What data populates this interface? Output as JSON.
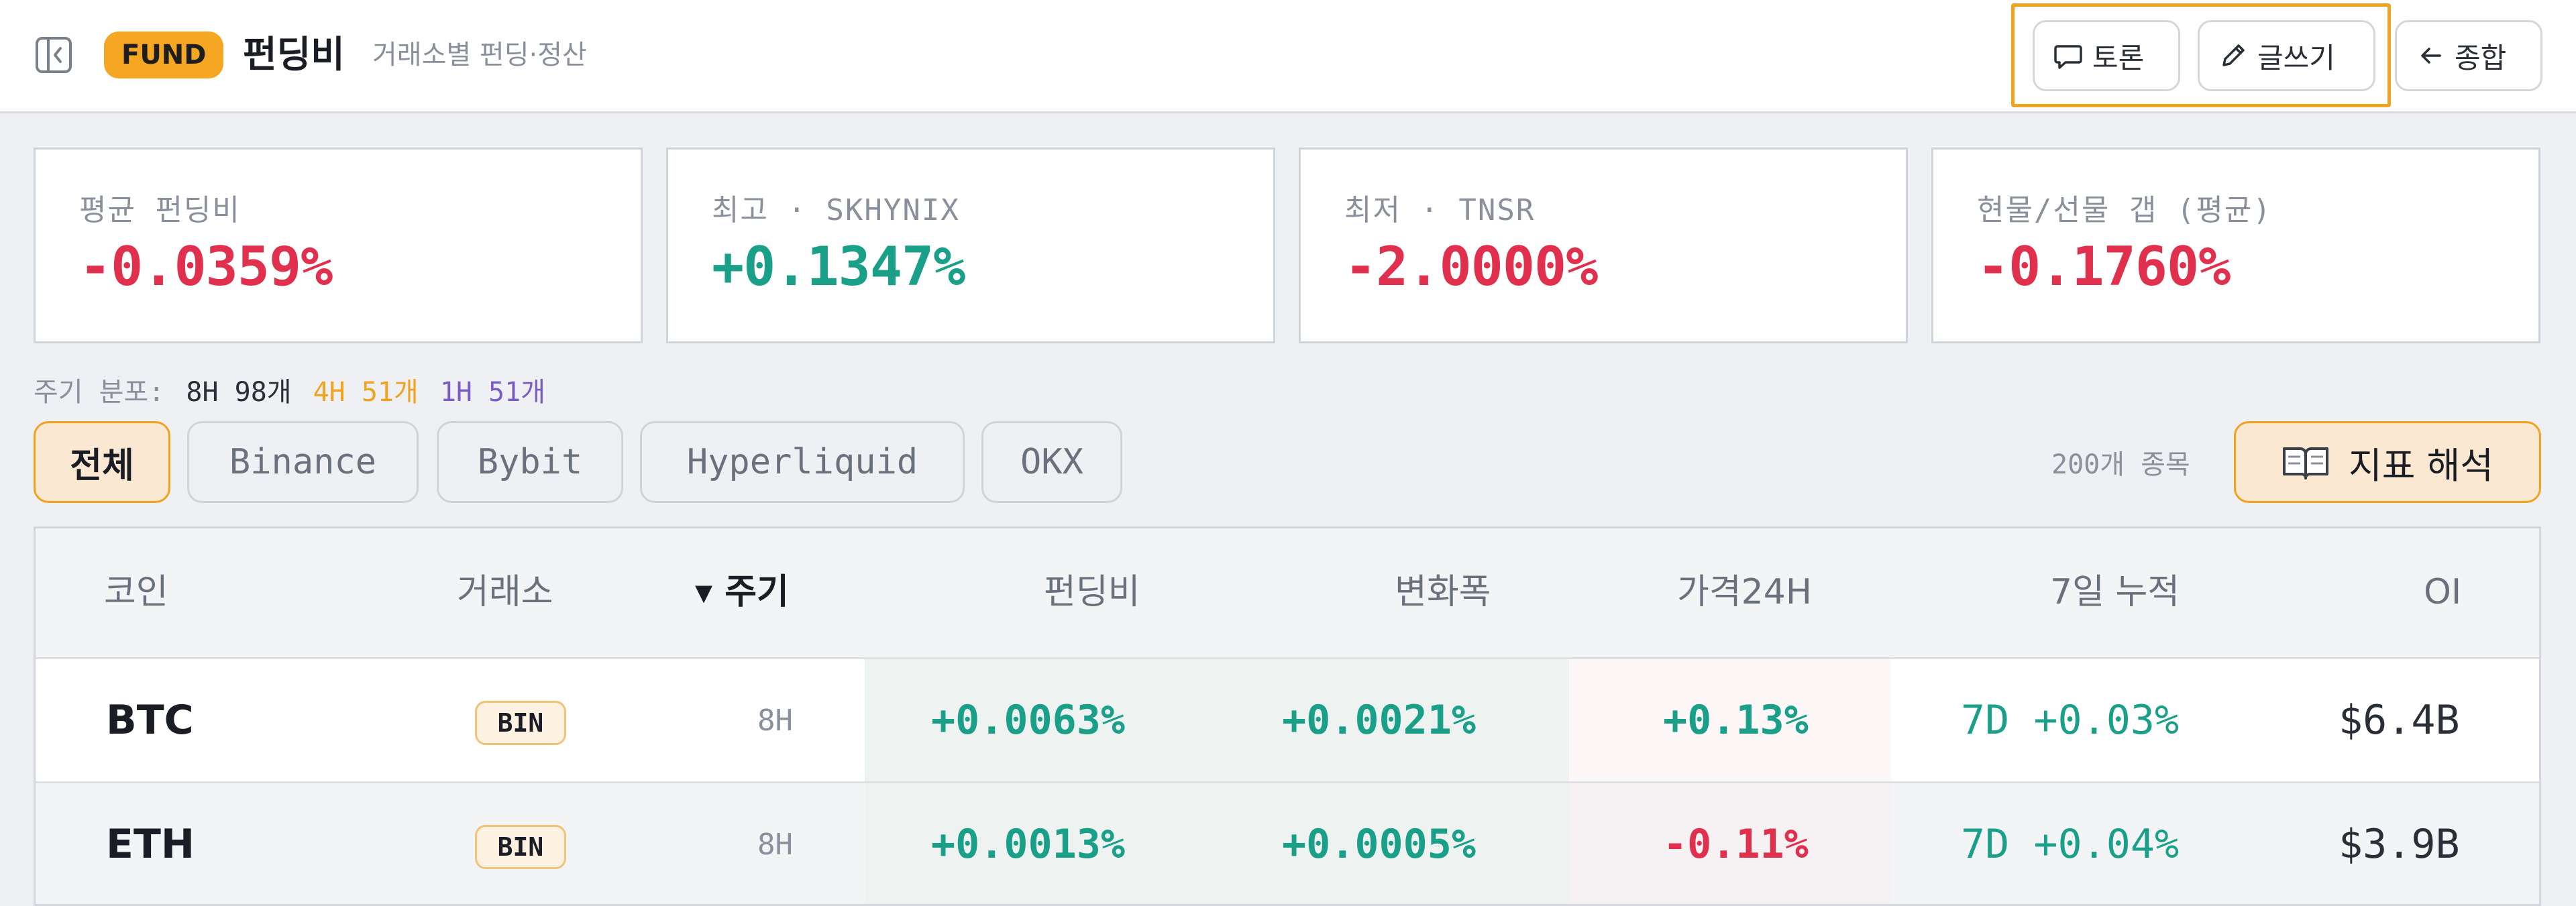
{
  "header": {
    "badge": "FUND",
    "title": "펀딩비",
    "subtitle": "거래소별 펀딩·정산",
    "buttons": {
      "discuss": "토론",
      "write": "글쓰기",
      "back": "종합"
    }
  },
  "stats": [
    {
      "label": "평균 펀딩비",
      "value": "-0.0359%",
      "tone": "negative"
    },
    {
      "label": "최고 · SKHYNIX",
      "value": "+0.1347%",
      "tone": "positive"
    },
    {
      "label": "최저 · TNSR",
      "value": "-2.0000%",
      "tone": "negative"
    },
    {
      "label": "현물/선물 갭 (평균)",
      "value": "-0.1760%",
      "tone": "negative"
    }
  ],
  "cycle_distribution": {
    "label": "주기 분포:",
    "h8": "8H 98개",
    "h4": "4H 51개",
    "h1": "1H 51개"
  },
  "filters": {
    "tabs": [
      "전체",
      "Binance",
      "Bybit",
      "Hyperliquid",
      "OKX"
    ],
    "active": "전체",
    "count": "200개 종목",
    "guide_label": "지표 해석"
  },
  "table": {
    "columns": [
      "코인",
      "거래소",
      "▾ 주기",
      "펀딩비",
      "변화폭",
      "가격24H",
      "7일 누적",
      "OI"
    ],
    "sorted_column": "주기",
    "rows": [
      {
        "coin": "BTC",
        "exchange": "BIN",
        "period": "8H",
        "funding": "+0.0063%",
        "change": "+0.0021%",
        "price24h": "+0.13%",
        "cum7d": "7D +0.03%",
        "oi": "$6.4B"
      },
      {
        "coin": "ETH",
        "exchange": "BIN",
        "period": "8H",
        "funding": "+0.0013%",
        "change": "+0.0005%",
        "price24h": "-0.11%",
        "cum7d": "7D +0.04%",
        "oi": "$3.9B"
      }
    ]
  },
  "colors": {
    "accent": "#f0a31e",
    "positive": "#1aa089",
    "negative": "#e0304d",
    "cycle_4h": "#f0a31e",
    "cycle_1h": "#7b5cc4"
  },
  "icons": {
    "sidebar_toggle": "sidebar-collapse-icon",
    "discuss": "chat-bubble-icon",
    "write": "pencil-icon",
    "back": "arrow-left-icon",
    "guide": "open-book-icon"
  }
}
